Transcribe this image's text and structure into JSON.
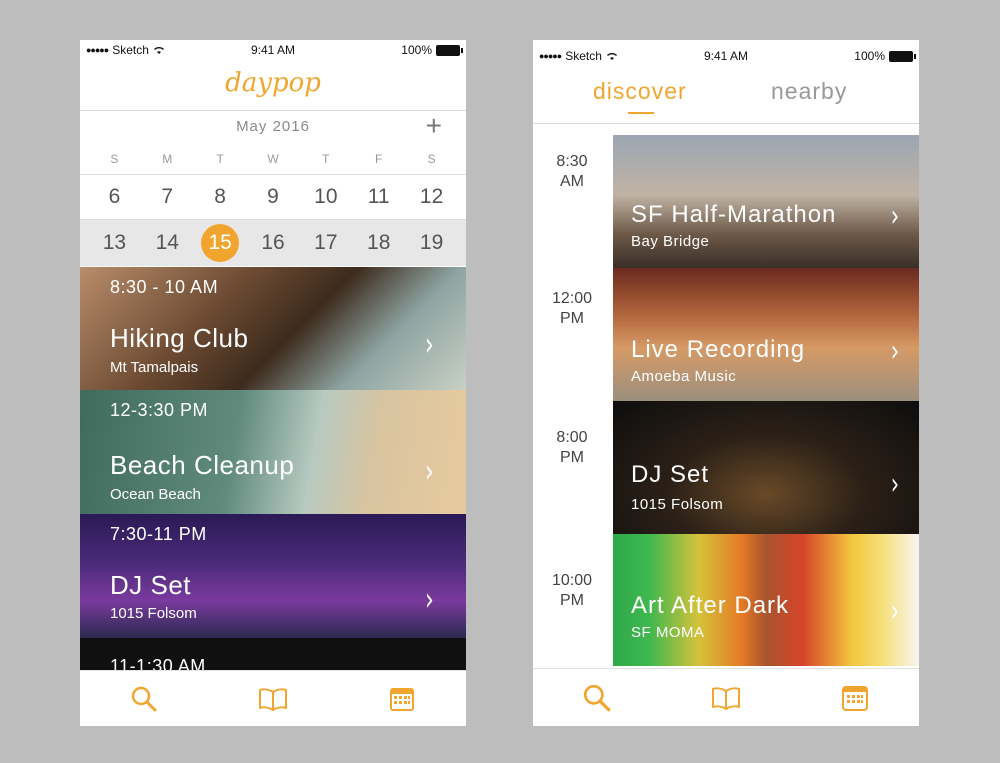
{
  "screen1": {
    "status": {
      "carrier": "Sketch",
      "time": "9:41 AM",
      "battery": "100%"
    },
    "logo": "daypop",
    "calendar": {
      "month": "May 2016",
      "add_label": "+",
      "weekdays": [
        "S",
        "M",
        "T",
        "W",
        "T",
        "F",
        "S"
      ],
      "week1": [
        "6",
        "7",
        "8",
        "9",
        "10",
        "11",
        "12"
      ],
      "week2": [
        "13",
        "14",
        "15",
        "16",
        "17",
        "18",
        "19"
      ],
      "selected": "15"
    },
    "events": [
      {
        "time": "8:30 - 10 AM",
        "title": "Hiking Club",
        "location": "Mt Tamalpais"
      },
      {
        "time": "12-3:30 PM",
        "title": "Beach Cleanup",
        "location": "Ocean Beach"
      },
      {
        "time": "7:30-11 PM",
        "title": "DJ Set",
        "location": "1015 Folsom"
      },
      {
        "time": "11-1:30 AM"
      }
    ]
  },
  "screen2": {
    "status": {
      "carrier": "Sketch",
      "time": "9:41 AM",
      "battery": "100%"
    },
    "tabs": {
      "discover": "discover",
      "nearby": "nearby"
    },
    "slots": [
      {
        "time_line1": "8:30",
        "time_line2": "AM",
        "title": "SF Half-Marathon",
        "location": "Bay Bridge"
      },
      {
        "time_line1": "12:00",
        "time_line2": "PM",
        "title": "Live Recording",
        "location": "Amoeba Music"
      },
      {
        "time_line1": "8:00",
        "time_line2": "PM",
        "title": "DJ Set",
        "location": "1015 Folsom"
      },
      {
        "time_line1": "10:00",
        "time_line2": "PM",
        "title": "Art After Dark",
        "location": "SF MOMA"
      }
    ]
  },
  "icons": {
    "search": "search-icon",
    "book": "book-icon",
    "calendar": "calendar-icon",
    "chevron": "chevron-right-icon"
  },
  "colors": {
    "accent": "#f2a52e",
    "background": "#bdbdbd"
  }
}
